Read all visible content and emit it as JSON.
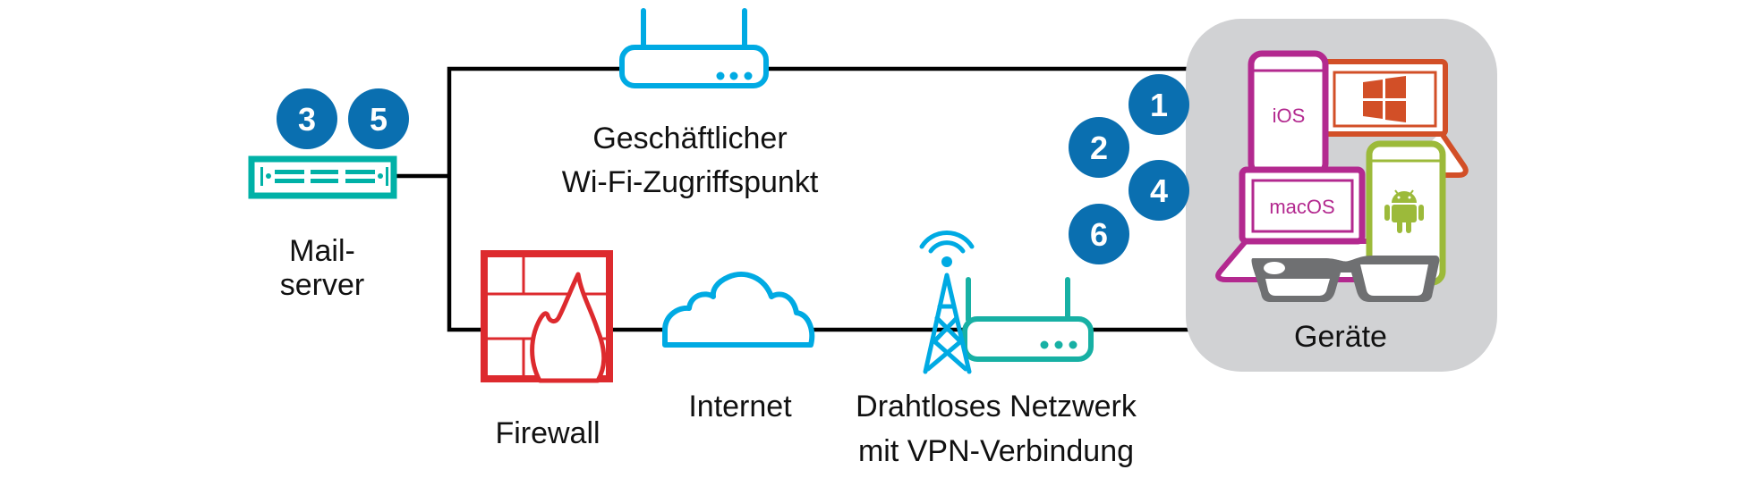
{
  "colors": {
    "badge": "#0a6fb0",
    "wifi_router": "#00aae3",
    "server": "#00b1a7",
    "firewall": "#dd2a2e",
    "cloud": "#00aae3",
    "tower": "#00aae3",
    "vpn_router": "#17b0a4",
    "device_panel": "#d1d2d4",
    "ios": "#b3298f",
    "macos": "#b3298f",
    "windows": "#d24f27",
    "android": "#9cba3a",
    "glasses": "#6f7072"
  },
  "nodes": {
    "mailserver": {
      "label_line1": "Mail-",
      "label_line2": "server",
      "icon": "server-icon"
    },
    "wifi_ap": {
      "label_line1": "Geschäftlicher",
      "label_line2": "Wi-Fi-Zugriffspunkt",
      "icon": "wifi-router-icon"
    },
    "firewall": {
      "label": "Firewall",
      "icon": "firewall-icon"
    },
    "internet": {
      "label": "Internet",
      "icon": "cloud-icon"
    },
    "vpn": {
      "label_line1": "Drahtloses Netzwerk",
      "label_line2": "mit VPN-Verbindung",
      "icon": "cell-tower-router-icon"
    },
    "devices": {
      "label": "Geräte",
      "items": [
        {
          "name": "iOS",
          "icon": "phone-icon"
        },
        {
          "name": "Windows",
          "icon": "windows-logo-icon"
        },
        {
          "name": "macOS",
          "icon": "laptop-icon"
        },
        {
          "name": "Android",
          "icon": "android-logo-icon"
        },
        {
          "name": "Smart glasses",
          "icon": "smart-glasses-icon"
        }
      ]
    }
  },
  "badges": {
    "server": [
      "3",
      "5"
    ],
    "devices": [
      "1",
      "2",
      "4",
      "6"
    ]
  }
}
